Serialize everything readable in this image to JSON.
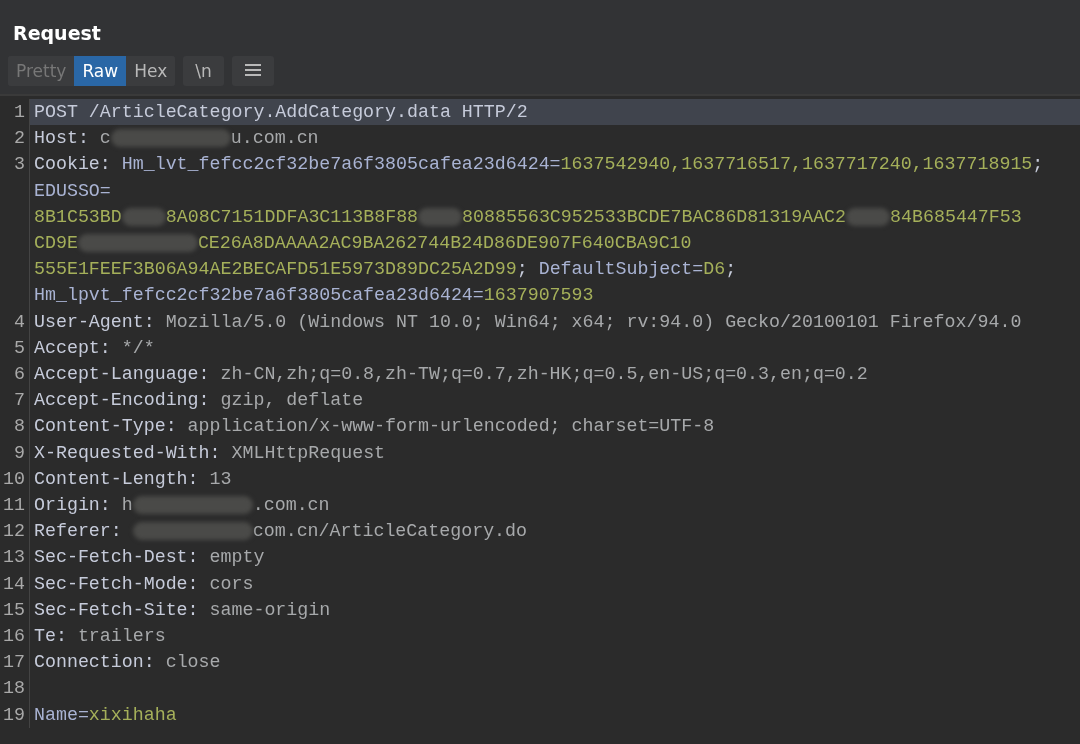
{
  "panel": {
    "title": "Request"
  },
  "view_tabs": [
    {
      "label": "Pretty",
      "selected": false,
      "disabled": true
    },
    {
      "label": "Raw",
      "selected": true,
      "disabled": false
    },
    {
      "label": "Hex",
      "selected": false,
      "disabled": false
    }
  ],
  "newline_toggle": {
    "label": "\\n",
    "on": false
  },
  "editor": {
    "lines": [
      {
        "number": "1",
        "selected": true,
        "rows": [
          {
            "segments": [
              {
                "kind": "name",
                "text": "POST /ArticleCategory.AddCategory.data HTTP/2"
              }
            ]
          }
        ]
      },
      {
        "number": "2",
        "selected": false,
        "rows": [
          {
            "segments": [
              {
                "kind": "name",
                "text": "Host: "
              },
              {
                "kind": "value",
                "text": "c"
              },
              {
                "kind": "redacted"
              },
              {
                "kind": "value",
                "text": "u.com.cn"
              }
            ]
          }
        ]
      },
      {
        "number": "3",
        "selected": false,
        "rows": [
          {
            "segments": [
              {
                "kind": "name",
                "text": "Cookie: "
              },
              {
                "kind": "cookie-name",
                "text": "Hm_lvt_fefcc2cf32be7a6f3805cafea23d6424="
              },
              {
                "kind": "cookie-value",
                "text": "1637542940,1637716517,1637717240,1637718915"
              },
              {
                "kind": "name",
                "text": ";"
              }
            ]
          },
          {
            "segments": [
              {
                "kind": "cookie-name",
                "text": "EDUSSO="
              }
            ]
          },
          {
            "segments": [
              {
                "kind": "cookie-value",
                "text": "8B1C53BD"
              },
              {
                "kind": "redacted"
              },
              {
                "kind": "cookie-value",
                "text": "8A08C7151DDFA3C113B8F88"
              },
              {
                "kind": "redacted"
              },
              {
                "kind": "cookie-value",
                "text": "80885563C952533BCDE7BAC86D81319AAC2"
              },
              {
                "kind": "redacted"
              },
              {
                "kind": "cookie-value",
                "text": "84B685447F53"
              }
            ]
          },
          {
            "segments": [
              {
                "kind": "cookie-value",
                "text": "CD9E"
              },
              {
                "kind": "redacted"
              },
              {
                "kind": "cookie-value",
                "text": "CE26A8DAAAA2AC9BA262744B24D86DE907F640CBA9C10"
              }
            ]
          },
          {
            "segments": [
              {
                "kind": "cookie-value",
                "text": "555E1FEEF3B06A94AE2BECAFD51E5973D89DC25A2D99"
              },
              {
                "kind": "name",
                "text": "; "
              },
              {
                "kind": "cookie-name",
                "text": "DefaultSubject="
              },
              {
                "kind": "cookie-value",
                "text": "D6"
              },
              {
                "kind": "name",
                "text": ";"
              }
            ]
          },
          {
            "segments": [
              {
                "kind": "cookie-name",
                "text": "Hm_lpvt_fefcc2cf32be7a6f3805cafea23d6424="
              },
              {
                "kind": "cookie-value",
                "text": "1637907593"
              }
            ]
          }
        ]
      },
      {
        "number": "4",
        "selected": false,
        "rows": [
          {
            "segments": [
              {
                "kind": "name",
                "text": "User-Agent: "
              },
              {
                "kind": "value",
                "text": "Mozilla/5.0 (Windows NT 10.0; Win64; x64; rv:94.0) Gecko/20100101 Firefox/94.0"
              }
            ]
          }
        ]
      },
      {
        "number": "5",
        "selected": false,
        "rows": [
          {
            "segments": [
              {
                "kind": "name",
                "text": "Accept: "
              },
              {
                "kind": "value",
                "text": "*/*"
              }
            ]
          }
        ]
      },
      {
        "number": "6",
        "selected": false,
        "rows": [
          {
            "segments": [
              {
                "kind": "name",
                "text": "Accept-Language: "
              },
              {
                "kind": "value",
                "text": "zh-CN,zh;q=0.8,zh-TW;q=0.7,zh-HK;q=0.5,en-US;q=0.3,en;q=0.2"
              }
            ]
          }
        ]
      },
      {
        "number": "7",
        "selected": false,
        "rows": [
          {
            "segments": [
              {
                "kind": "name",
                "text": "Accept-Encoding: "
              },
              {
                "kind": "value",
                "text": "gzip, deflate"
              }
            ]
          }
        ]
      },
      {
        "number": "8",
        "selected": false,
        "rows": [
          {
            "segments": [
              {
                "kind": "name",
                "text": "Content-Type: "
              },
              {
                "kind": "value",
                "text": "application/x-www-form-urlencoded; charset=UTF-8"
              }
            ]
          }
        ]
      },
      {
        "number": "9",
        "selected": false,
        "rows": [
          {
            "segments": [
              {
                "kind": "name",
                "text": "X-Requested-With: "
              },
              {
                "kind": "value",
                "text": "XMLHttpRequest"
              }
            ]
          }
        ]
      },
      {
        "number": "10",
        "selected": false,
        "rows": [
          {
            "segments": [
              {
                "kind": "name",
                "text": "Content-Length: "
              },
              {
                "kind": "value",
                "text": "13"
              }
            ]
          }
        ]
      },
      {
        "number": "11",
        "selected": false,
        "rows": [
          {
            "segments": [
              {
                "kind": "name",
                "text": "Origin: "
              },
              {
                "kind": "value",
                "text": "h"
              },
              {
                "kind": "redacted"
              },
              {
                "kind": "value",
                "text": ".com.cn"
              }
            ]
          }
        ]
      },
      {
        "number": "12",
        "selected": false,
        "rows": [
          {
            "segments": [
              {
                "kind": "name",
                "text": "Referer: "
              },
              {
                "kind": "redacted"
              },
              {
                "kind": "value",
                "text": "com.cn/ArticleCategory.do"
              }
            ]
          }
        ]
      },
      {
        "number": "13",
        "selected": false,
        "rows": [
          {
            "segments": [
              {
                "kind": "name",
                "text": "Sec-Fetch-Dest: "
              },
              {
                "kind": "value",
                "text": "empty"
              }
            ]
          }
        ]
      },
      {
        "number": "14",
        "selected": false,
        "rows": [
          {
            "segments": [
              {
                "kind": "name",
                "text": "Sec-Fetch-Mode: "
              },
              {
                "kind": "value",
                "text": "cors"
              }
            ]
          }
        ]
      },
      {
        "number": "15",
        "selected": false,
        "rows": [
          {
            "segments": [
              {
                "kind": "name",
                "text": "Sec-Fetch-Site: "
              },
              {
                "kind": "value",
                "text": "same-origin"
              }
            ]
          }
        ]
      },
      {
        "number": "16",
        "selected": false,
        "rows": [
          {
            "segments": [
              {
                "kind": "name",
                "text": "Te: "
              },
              {
                "kind": "value",
                "text": "trailers"
              }
            ]
          }
        ]
      },
      {
        "number": "17",
        "selected": false,
        "rows": [
          {
            "segments": [
              {
                "kind": "name",
                "text": "Connection: "
              },
              {
                "kind": "value",
                "text": "close"
              }
            ]
          }
        ]
      },
      {
        "number": "18",
        "selected": false
      },
      {
        "number": "19",
        "selected": false,
        "rows": [
          {
            "segments": [
              {
                "kind": "cookie-name",
                "text": "Name="
              },
              {
                "kind": "cookie-value",
                "text": "xixihaha"
              }
            ]
          }
        ]
      }
    ]
  }
}
